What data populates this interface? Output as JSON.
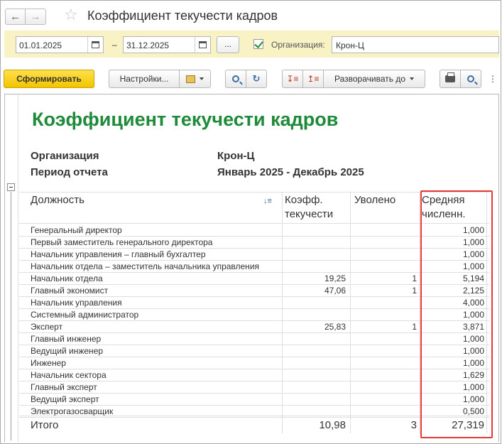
{
  "window": {
    "title": "Коэффициент текучести кадров"
  },
  "params": {
    "date_from": "01.01.2025",
    "date_to": "31.12.2025",
    "dash": "–",
    "dots": "...",
    "org_label": "Организация:",
    "org_value": "Крон-Ц"
  },
  "toolbar": {
    "form_label": "Сформировать",
    "settings_label": "Настройки...",
    "expand_label": "Разворачивать до",
    "more": "⋮"
  },
  "report": {
    "title": "Коэффициент текучести кадров",
    "org_label": "Организация",
    "org_value": "Крон-Ц",
    "period_label": "Период отчета",
    "period_value": "Январь 2025 - Декабрь 2025",
    "headers": {
      "position": "Должность",
      "coef_1": "Коэфф.",
      "coef_2": "текучести",
      "fired": "Уволено",
      "avg_1": "Средняя",
      "avg_2": "численн."
    },
    "rows": [
      {
        "position": "Генеральный директор",
        "coef": "",
        "fired": "",
        "avg": "1,000"
      },
      {
        "position": "Первый заместитель генерального директора",
        "coef": "",
        "fired": "",
        "avg": "1,000"
      },
      {
        "position": "Начальник управления – главный бухгалтер",
        "coef": "",
        "fired": "",
        "avg": "1,000"
      },
      {
        "position": "Начальник отдела – заместитель начальника управления",
        "coef": "",
        "fired": "",
        "avg": "1,000"
      },
      {
        "position": "Начальник отдела",
        "coef": "19,25",
        "fired": "1",
        "avg": "5,194"
      },
      {
        "position": "Главный экономист",
        "coef": "47,06",
        "fired": "1",
        "avg": "2,125"
      },
      {
        "position": "Начальник управления",
        "coef": "",
        "fired": "",
        "avg": "4,000"
      },
      {
        "position": "Системный администратор",
        "coef": "",
        "fired": "",
        "avg": "1,000"
      },
      {
        "position": "Эксперт",
        "coef": "25,83",
        "fired": "1",
        "avg": "3,871"
      },
      {
        "position": "Главный инженер",
        "coef": "",
        "fired": "",
        "avg": "1,000"
      },
      {
        "position": "Ведущий инженер",
        "coef": "",
        "fired": "",
        "avg": "1,000"
      },
      {
        "position": "Инженер",
        "coef": "",
        "fired": "",
        "avg": "1,000"
      },
      {
        "position": "Начальник сектора",
        "coef": "",
        "fired": "",
        "avg": "1,629"
      },
      {
        "position": "Главный эксперт",
        "coef": "",
        "fired": "",
        "avg": "1,000"
      },
      {
        "position": "Ведущий эксперт",
        "coef": "",
        "fired": "",
        "avg": "1,000"
      },
      {
        "position": "Электрогазосварщик",
        "coef": "",
        "fired": "",
        "avg": "0,500"
      }
    ],
    "total": {
      "label": "Итого",
      "coef": "10,98",
      "fired": "3",
      "avg": "27,319"
    }
  },
  "colors": {
    "title_green": "#1f8a3a",
    "param_bg": "#f9f2c4",
    "form_button": "#f2c400",
    "highlight": "#e53935"
  }
}
